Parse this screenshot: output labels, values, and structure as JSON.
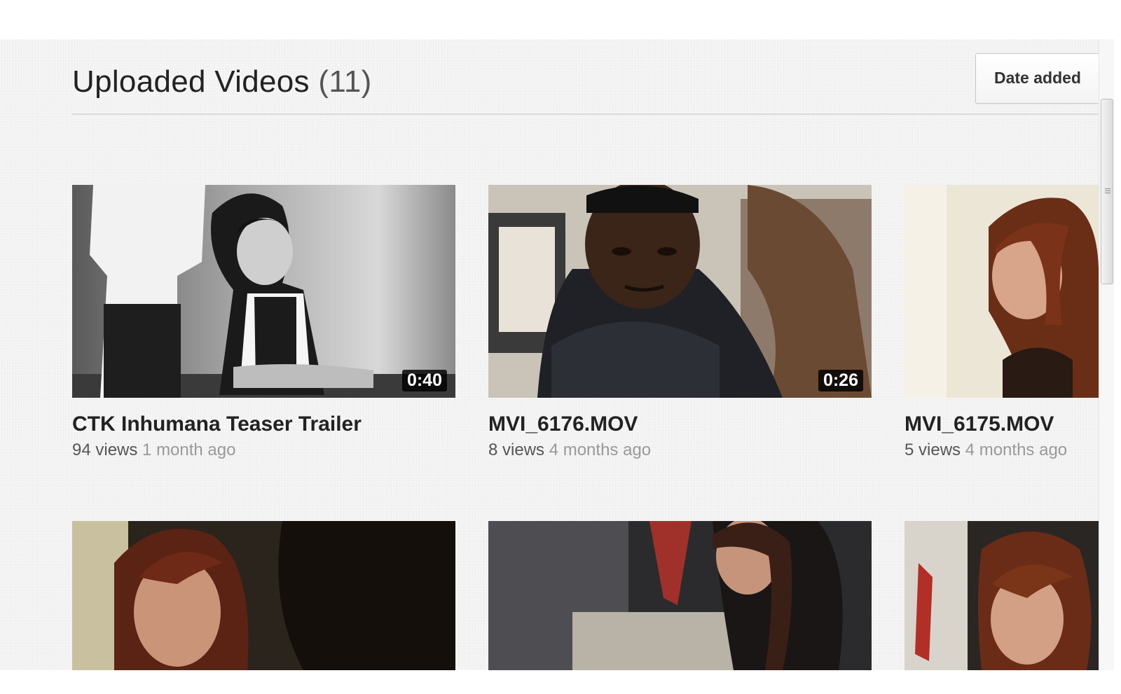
{
  "header": {
    "title": "Uploaded Videos",
    "count": "(11)",
    "sort_label": "Date added"
  },
  "videos": [
    {
      "title": "CTK Inhumana Teaser Trailer",
      "duration": "0:40",
      "views": "94 views",
      "age": "1 month ago"
    },
    {
      "title": "MVI_6176.MOV",
      "duration": "0:26",
      "views": "8 views",
      "age": "4 months ago"
    },
    {
      "title": "MVI_6175.MOV",
      "duration": "",
      "views": "5 views",
      "age": "4 months ago"
    },
    {
      "title": "",
      "duration": "",
      "views": "",
      "age": ""
    },
    {
      "title": "",
      "duration": "",
      "views": "",
      "age": ""
    },
    {
      "title": "",
      "duration": "",
      "views": "",
      "age": ""
    }
  ]
}
